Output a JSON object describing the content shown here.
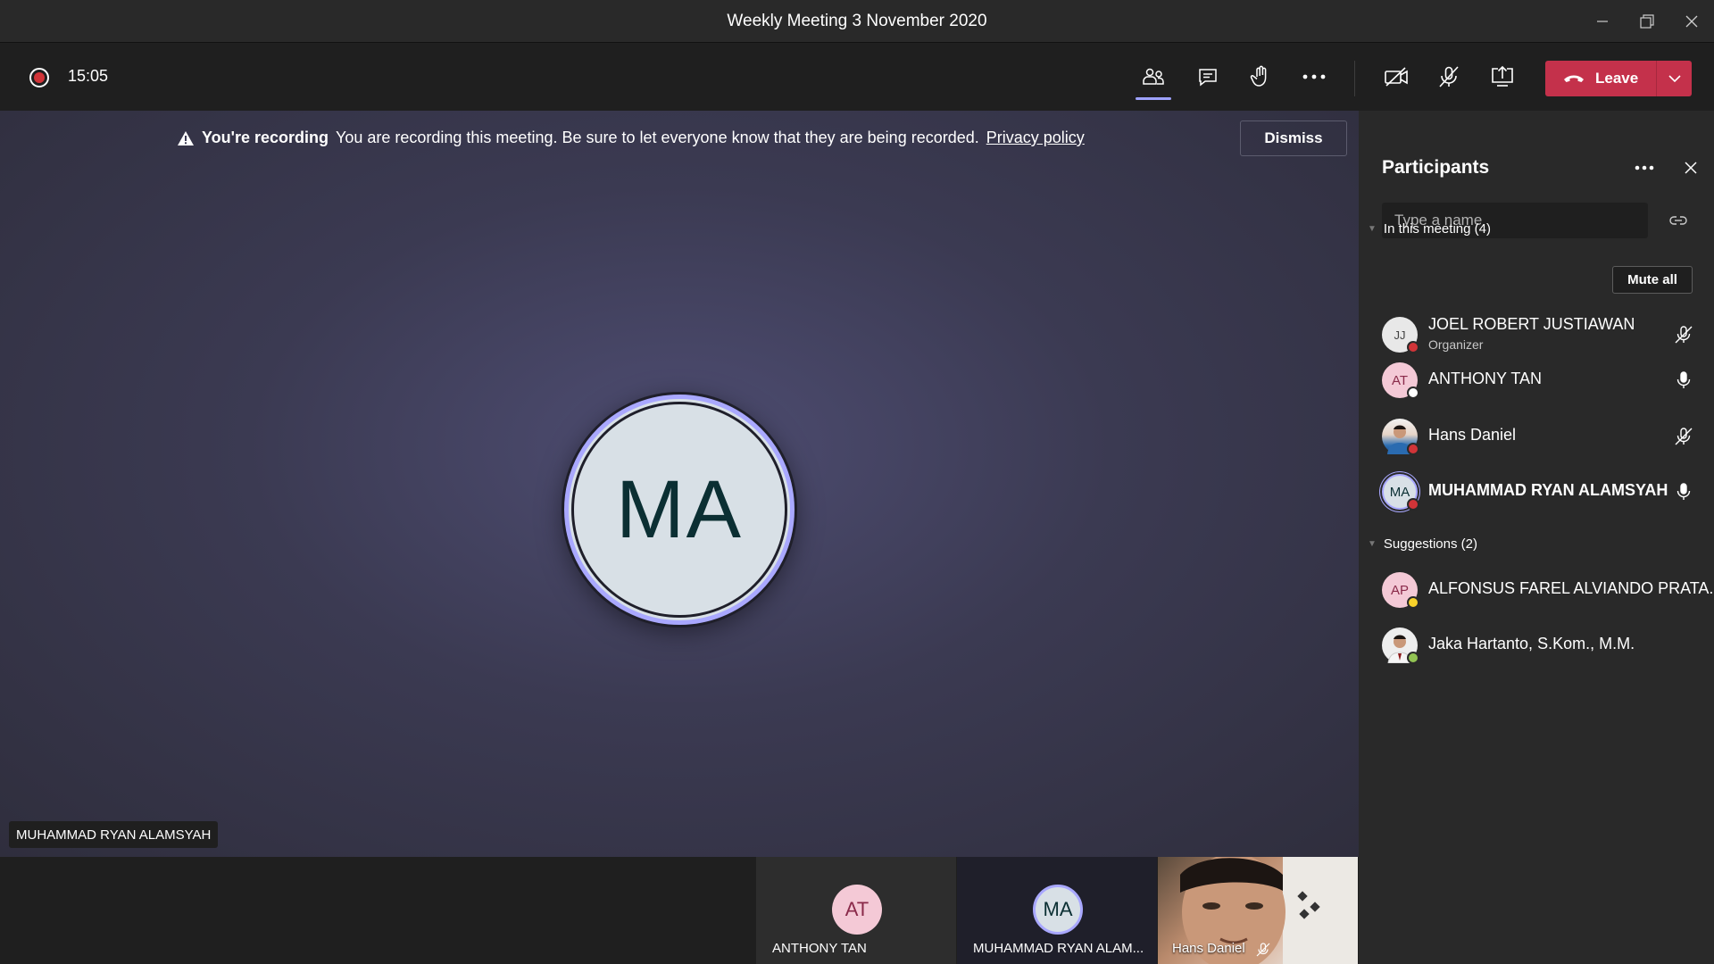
{
  "window": {
    "title": "Weekly Meeting 3 November 2020"
  },
  "toolbar": {
    "timer": "15:05",
    "leave_label": "Leave",
    "icons": [
      "participants-icon",
      "chat-icon",
      "raise-hand-icon",
      "more-icon",
      "camera-off-icon",
      "mic-off-icon",
      "share-screen-icon"
    ]
  },
  "banner": {
    "title": "You're recording",
    "message": "You are recording this meeting. Be sure to let everyone know that they are being recorded.",
    "link": "Privacy policy",
    "dismiss_label": "Dismiss"
  },
  "stage": {
    "avatar_initials": "MA",
    "speaker_name": "MUHAMMAD RYAN ALAMSYAH"
  },
  "strip": {
    "tiles": [
      {
        "initials": "AT",
        "name": "ANTHONY TAN"
      },
      {
        "initials": "MA",
        "name": "MUHAMMAD RYAN ALAM..."
      },
      {
        "initials": "",
        "name": "Hans Daniel"
      }
    ]
  },
  "panel": {
    "title": "Participants",
    "search_placeholder": "Type a name",
    "in_meeting_label": "In this meeting (4)",
    "mute_all_label": "Mute all",
    "in_meeting": [
      {
        "initials": "JJ",
        "name": "JOEL ROBERT JUSTIAWAN",
        "role": "Organizer",
        "mic": "muted",
        "status": "busy"
      },
      {
        "initials": "AT",
        "name": "ANTHONY TAN",
        "role": "",
        "mic": "on",
        "status": "offline"
      },
      {
        "initials": "",
        "name": "Hans Daniel",
        "role": "",
        "mic": "muted",
        "status": "busy"
      },
      {
        "initials": "MA",
        "name": "MUHAMMAD RYAN ALAMSYAH",
        "role": "",
        "mic": "on",
        "status": "busy"
      }
    ],
    "suggestions_label": "Suggestions (2)",
    "suggestions": [
      {
        "initials": "AP",
        "name": "ALFONSUS FAREL ALVIANDO PRATA...",
        "status": "away"
      },
      {
        "initials": "",
        "name": "Jaka Hartanto, S.Kom., M.M.",
        "status": "available"
      }
    ]
  },
  "colors": {
    "leave": "#c4314b",
    "accent": "#9ea2ff",
    "busy": "#d13438",
    "away": "#f8d22a",
    "available": "#92c353"
  }
}
